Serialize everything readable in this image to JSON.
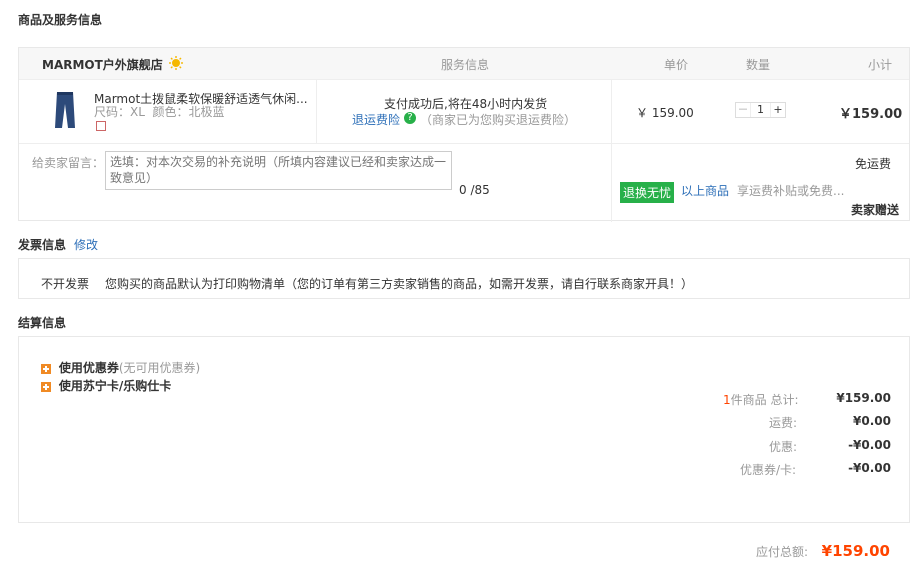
{
  "colors": {
    "accent_orange": "#ff6600",
    "link_blue": "#2d6fb8",
    "tag_green": "#27b049",
    "price_red": "#ff4400"
  },
  "goods_section": {
    "title": "商品及服务信息",
    "store_name": "MARMOT户外旗舰店",
    "store_icon": "sun-badge-icon",
    "columns": {
      "service": "服务信息",
      "unit_price": "单价",
      "quantity": "数量",
      "subtotal": "小计"
    },
    "product": {
      "name": "Marmot土拨鼠柔软保暖舒适透气休闲...",
      "spec": "尺码：XL  颜色：北极蓝",
      "service_line1": "支付成功后,将在48小时内发货",
      "return_insurance": "退运费险",
      "insurance_note": "（商家已为您购买退运费险）",
      "unit_price": "￥ 159.00",
      "quantity_minus": "－",
      "quantity": "1",
      "quantity_plus": "+",
      "subtotal": "￥159.00"
    },
    "remark_label": "给卖家留言：",
    "remark_placeholder": "选填：对本次交易的补充说明（所填内容建议已经和卖家达成一致意见）",
    "remark_counter": "0 /85",
    "free_shipping": "免运费",
    "return_tag": "退换无忧",
    "return_link": "以上商品",
    "return_text": "享运费补贴或免费...",
    "seller_gift": "卖家赠送"
  },
  "invoice": {
    "title": "发票信息",
    "edit": "修改",
    "type": "不开发票",
    "note": "您购买的商品默认为打印购物清单（您的订单有第三方卖家销售的商品，如需开发票，请自行联系商家开具！）"
  },
  "settlement": {
    "title": "结算信息",
    "coupon_label": "使用优惠券",
    "coupon_note": "(无可用优惠券)",
    "card_label": "使用苏宁卡/乐购仕卡",
    "count_num": "1",
    "count_text": "件商品 总计:",
    "total": "¥159.00",
    "shipping_label": "运费:",
    "shipping": "¥0.00",
    "discount_label": "优惠:",
    "discount": "-¥0.00",
    "coupon_card_label": "优惠券/卡:",
    "coupon_card": "-¥0.00",
    "payable_label": "应付总额:",
    "payable": "¥159.00"
  }
}
